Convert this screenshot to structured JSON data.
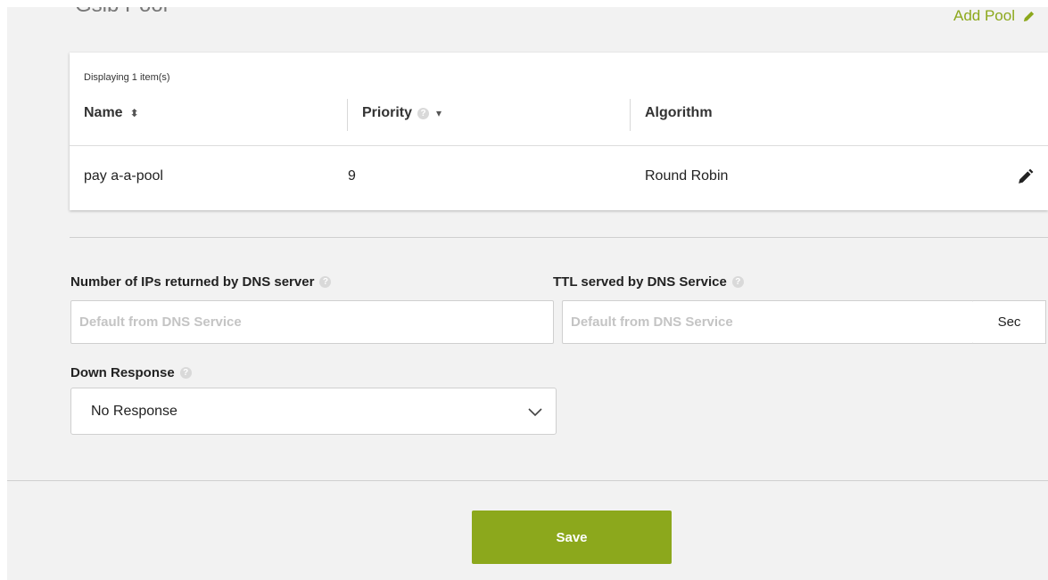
{
  "header": {
    "section_title": "Gslb Pool",
    "add_pool_label": "Add Pool"
  },
  "table": {
    "display_count": "Displaying 1 item(s)",
    "columns": [
      "Name",
      "Priority",
      "Algorithm"
    ],
    "rows": [
      {
        "name": "pay a-a-pool",
        "priority": "9",
        "algorithm": "Round Robin"
      }
    ]
  },
  "form": {
    "num_ips_label": "Number of IPs returned by DNS server",
    "num_ips_placeholder": "Default from DNS Service",
    "ttl_label": "TTL served by DNS Service",
    "ttl_placeholder": "Default from DNS Service",
    "ttl_unit": "Sec",
    "down_response_label": "Down Response",
    "down_response_value": "No Response"
  },
  "footer": {
    "save_label": "Save"
  },
  "colors": {
    "accent": "#8ca81c",
    "page_bg": "#f2f2f2"
  }
}
